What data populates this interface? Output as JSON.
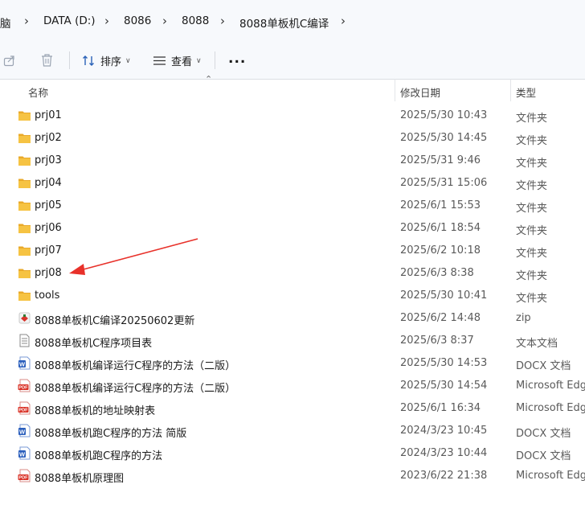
{
  "breadcrumb": {
    "items": [
      "脑",
      "DATA (D:)",
      "8086",
      "8088",
      "8088单板机C编译"
    ]
  },
  "toolbar": {
    "sort_label": "排序",
    "view_label": "查看",
    "more_label": "..."
  },
  "columns": {
    "name": "名称",
    "date": "修改日期",
    "type": "类型"
  },
  "files": [
    {
      "name": "prj01",
      "date": "2025/5/30 10:43",
      "type": "文件夹",
      "icon": "folder"
    },
    {
      "name": "prj02",
      "date": "2025/5/30 14:45",
      "type": "文件夹",
      "icon": "folder"
    },
    {
      "name": "prj03",
      "date": "2025/5/31 9:46",
      "type": "文件夹",
      "icon": "folder"
    },
    {
      "name": "prj04",
      "date": "2025/5/31 15:06",
      "type": "文件夹",
      "icon": "folder"
    },
    {
      "name": "prj05",
      "date": "2025/6/1 15:53",
      "type": "文件夹",
      "icon": "folder"
    },
    {
      "name": "prj06",
      "date": "2025/6/1 18:54",
      "type": "文件夹",
      "icon": "folder"
    },
    {
      "name": "prj07",
      "date": "2025/6/2 10:18",
      "type": "文件夹",
      "icon": "folder"
    },
    {
      "name": "prj08",
      "date": "2025/6/3 8:38",
      "type": "文件夹",
      "icon": "folder"
    },
    {
      "name": "tools",
      "date": "2025/5/30 10:41",
      "type": "文件夹",
      "icon": "folder"
    },
    {
      "name": "8088单板机C编译20250602更新",
      "date": "2025/6/2 14:48",
      "type": "zip",
      "icon": "zip"
    },
    {
      "name": "8088单板机C程序项目表",
      "date": "2025/6/3 8:37",
      "type": "文本文档",
      "icon": "text"
    },
    {
      "name": "8088单板机编译运行C程序的方法（二版）",
      "date": "2025/5/30 14:53",
      "type": "DOCX 文档",
      "icon": "word"
    },
    {
      "name": "8088单板机编译运行C程序的方法（二版）",
      "date": "2025/5/30 14:54",
      "type": "Microsoft Edge",
      "icon": "pdf"
    },
    {
      "name": "8088单板机的地址映射表",
      "date": "2025/6/1 16:34",
      "type": "Microsoft Edge",
      "icon": "pdf"
    },
    {
      "name": "8088单板机跑C程序的方法  简版",
      "date": "2024/3/23 10:45",
      "type": "DOCX 文档",
      "icon": "word"
    },
    {
      "name": "8088单板机跑C程序的方法",
      "date": "2024/3/23 10:44",
      "type": "DOCX 文档",
      "icon": "word"
    },
    {
      "name": "8088单板机原理图",
      "date": "2023/6/22 21:38",
      "type": "Microsoft Edge",
      "icon": "pdf"
    }
  ],
  "colors": {
    "folder": "#f6c343",
    "annotation_arrow": "#e8312a",
    "word": "#2b5fbd",
    "pdf": "#d93025"
  }
}
